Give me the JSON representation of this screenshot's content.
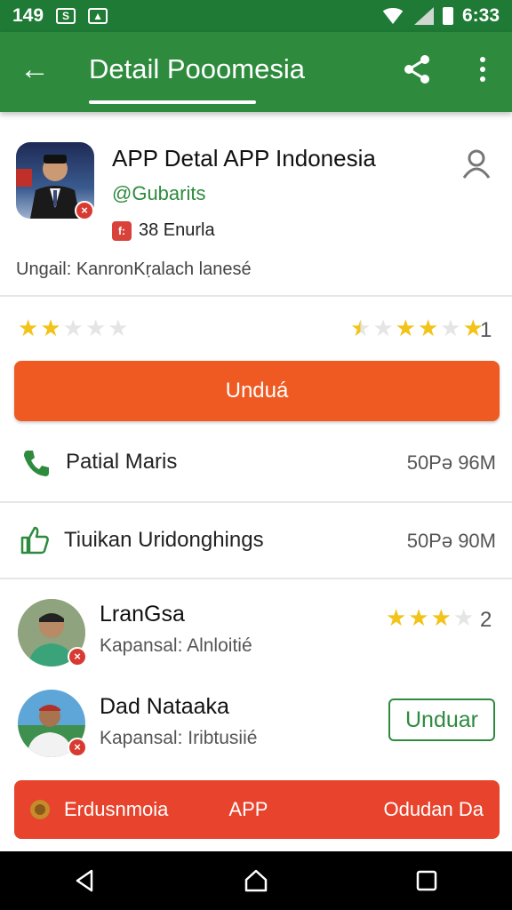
{
  "status_bar": {
    "time": "6:33",
    "left_number": "149"
  },
  "app_bar": {
    "title": "Detail Pooomesia"
  },
  "app": {
    "title": "APP Detal APP Indonesia",
    "handle": "@Gubarits",
    "count": "38 Enurla",
    "info": "Ungail: KanronKṛalach lanesé"
  },
  "ratings": {
    "right_number": "1",
    "left_stars": 2,
    "right_stars_label": "1"
  },
  "download_button": {
    "label": "Unduá"
  },
  "info_rows": [
    {
      "label": "Patial Maris",
      "value": "50Pə 96M",
      "icon": "phone-icon"
    },
    {
      "label": "Tiuikan Uridonghings",
      "value": "50Pə 90M",
      "icon": "thumbs-up-icon"
    }
  ],
  "reviews": [
    {
      "name": "LranGsa",
      "subtitle": "Kapansal: Alnloitié",
      "rating_number": "2"
    },
    {
      "name": "Dad Nataaka",
      "subtitle": "Kapansal: Iribtusiié",
      "button_label": "Unduar"
    }
  ],
  "banner": {
    "left": "Erdusnmoia",
    "middle": "APP",
    "right": "Odudan Da"
  },
  "colors": {
    "primary_green": "#2e8b3e",
    "accent_orange": "#ef5a22",
    "banner_red": "#e8432c",
    "star_yellow": "#f2c318"
  }
}
